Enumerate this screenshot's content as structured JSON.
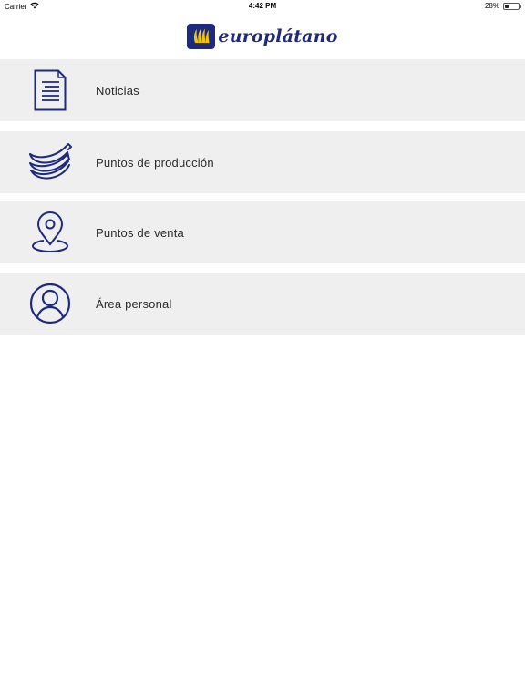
{
  "status_bar": {
    "carrier": "Carrier",
    "time": "4:42 PM",
    "battery": "28%",
    "battery_level": 0.28
  },
  "header": {
    "logo_text": "europlátano",
    "brand_color": "#1d2a7e",
    "logo_accent_color": "#f2c500"
  },
  "menu": {
    "background": "#efefef",
    "items": [
      {
        "label": "Noticias",
        "icon": "document-icon"
      },
      {
        "label": "Puntos de producción",
        "icon": "bananas-icon"
      },
      {
        "label": "Puntos de venta",
        "icon": "map-pin-icon"
      },
      {
        "label": "Área personal",
        "icon": "user-icon"
      }
    ]
  }
}
